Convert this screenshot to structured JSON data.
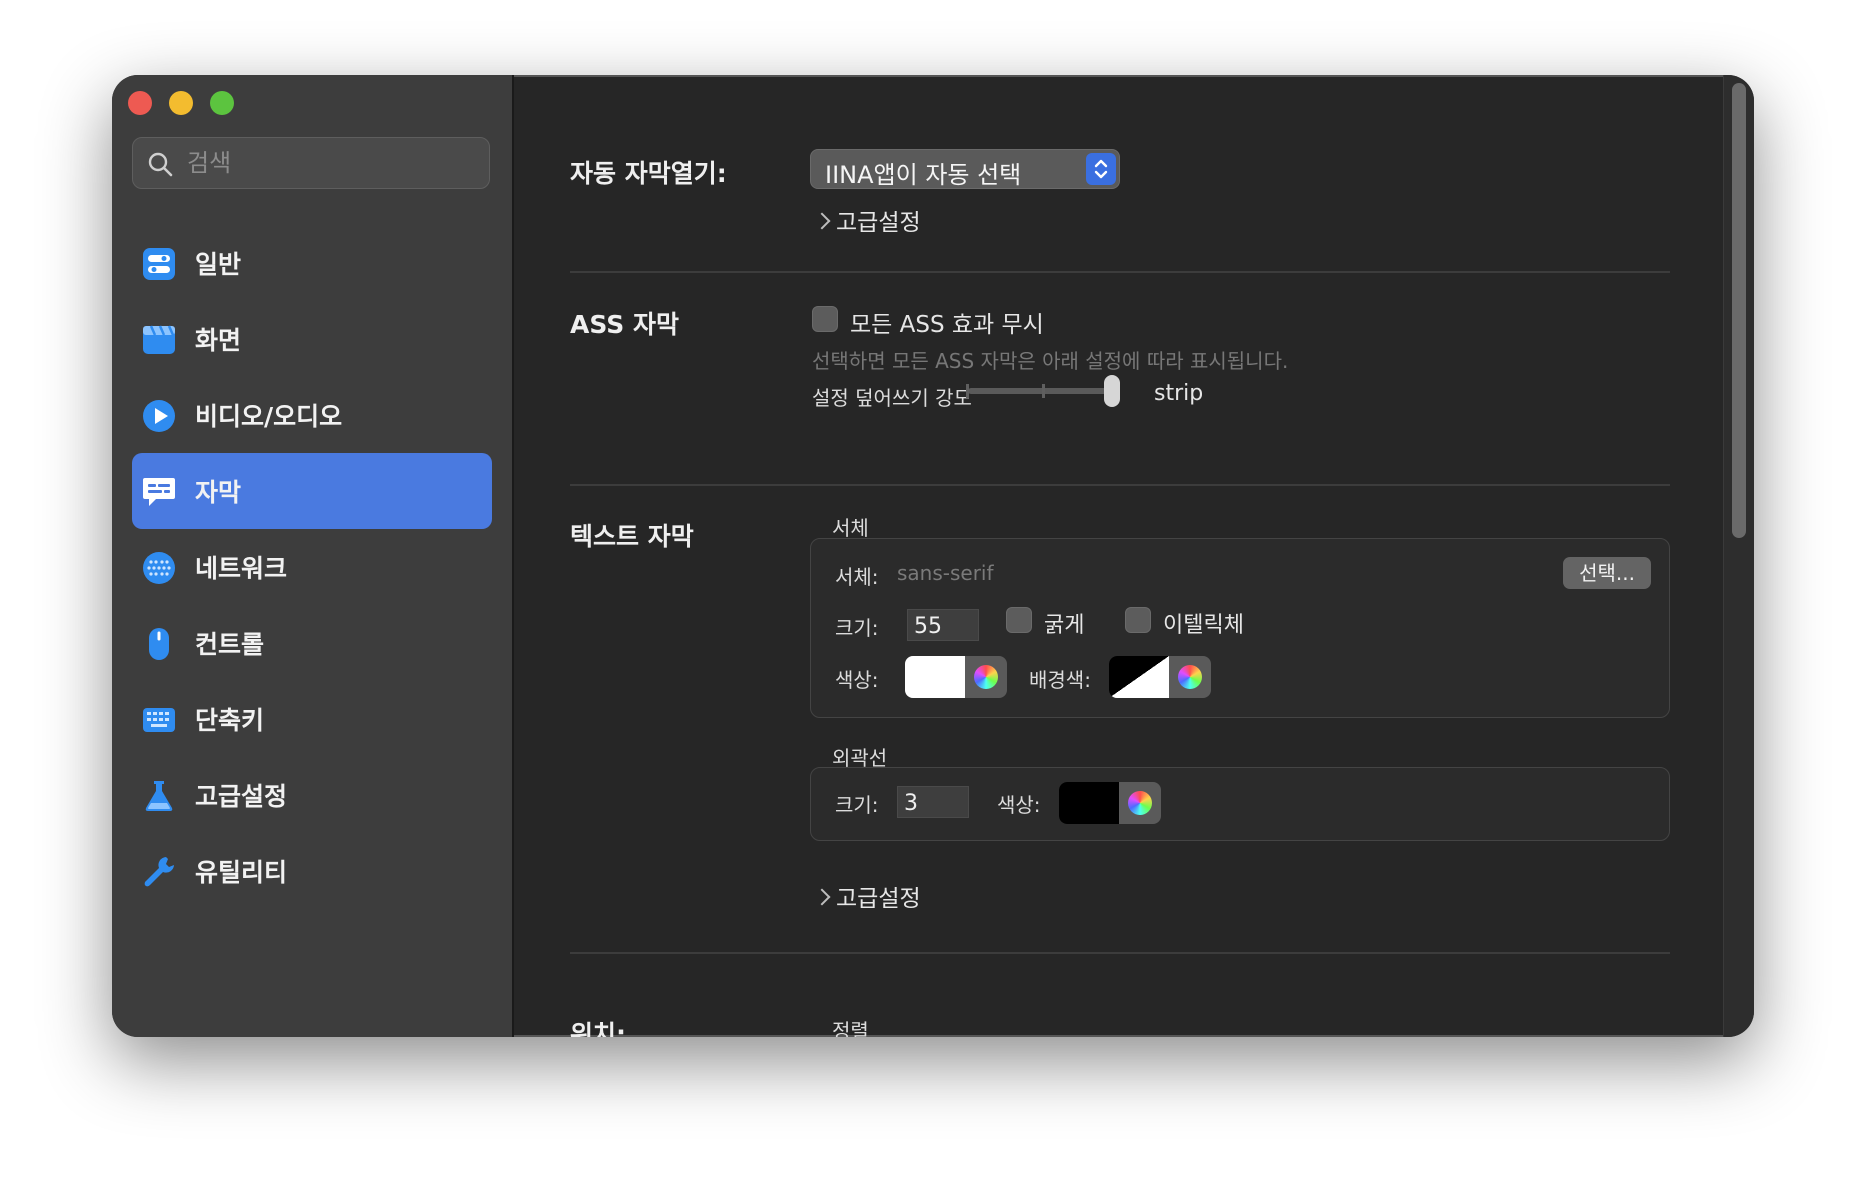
{
  "search": {
    "placeholder": "검색"
  },
  "sidebar": {
    "items": [
      {
        "label": "일반",
        "icon": "toggles-icon"
      },
      {
        "label": "화면",
        "icon": "clapper-icon"
      },
      {
        "label": "비디오/오디오",
        "icon": "play-icon"
      },
      {
        "label": "자막",
        "icon": "subtitle-bubble-icon",
        "selected": true
      },
      {
        "label": "네트워크",
        "icon": "globe-icon"
      },
      {
        "label": "컨트롤",
        "icon": "mouse-icon"
      },
      {
        "label": "단축키",
        "icon": "keyboard-icon"
      },
      {
        "label": "고급설정",
        "icon": "flask-icon"
      },
      {
        "label": "유틸리티",
        "icon": "wrench-icon"
      }
    ]
  },
  "auto_load": {
    "label": "자동 자막열기:",
    "value": "IINA앱이 자동 선택",
    "advanced": "고급설정"
  },
  "ass": {
    "label": "ASS 자막",
    "ignore_label": "모든 ASS 효과 무시",
    "ignore_checked": false,
    "hint": "선택하면 모든 ASS 자막은 아래 설정에 따라 표시됩니다.",
    "override_label": "설정 덮어쓰기 강도",
    "override_value": "strip"
  },
  "text_sub": {
    "label": "텍스트 자막",
    "font_section": "서체",
    "font_label": "서체:",
    "font_value": "sans-serif",
    "choose_button": "선택...",
    "size_label": "크기:",
    "size_value": "55",
    "bold_label": "굵게",
    "bold_checked": false,
    "italic_label": "이텔릭체",
    "italic_checked": false,
    "color_label": "색상:",
    "bgcolor_label": "배경색:",
    "border_section": "외곽선",
    "border_size_label": "크기:",
    "border_size_value": "3",
    "border_color_label": "색상:",
    "advanced": "고급설정"
  },
  "position": {
    "label": "위치:",
    "align_label": "정렬"
  },
  "colors": {
    "accent": "#4a7ae0",
    "sidebar_bg": "#3d3d3d",
    "content_bg": "#262626",
    "icon_blue": "#2f8cf0",
    "font_color": "#ffffff",
    "border_color": "#000000"
  }
}
